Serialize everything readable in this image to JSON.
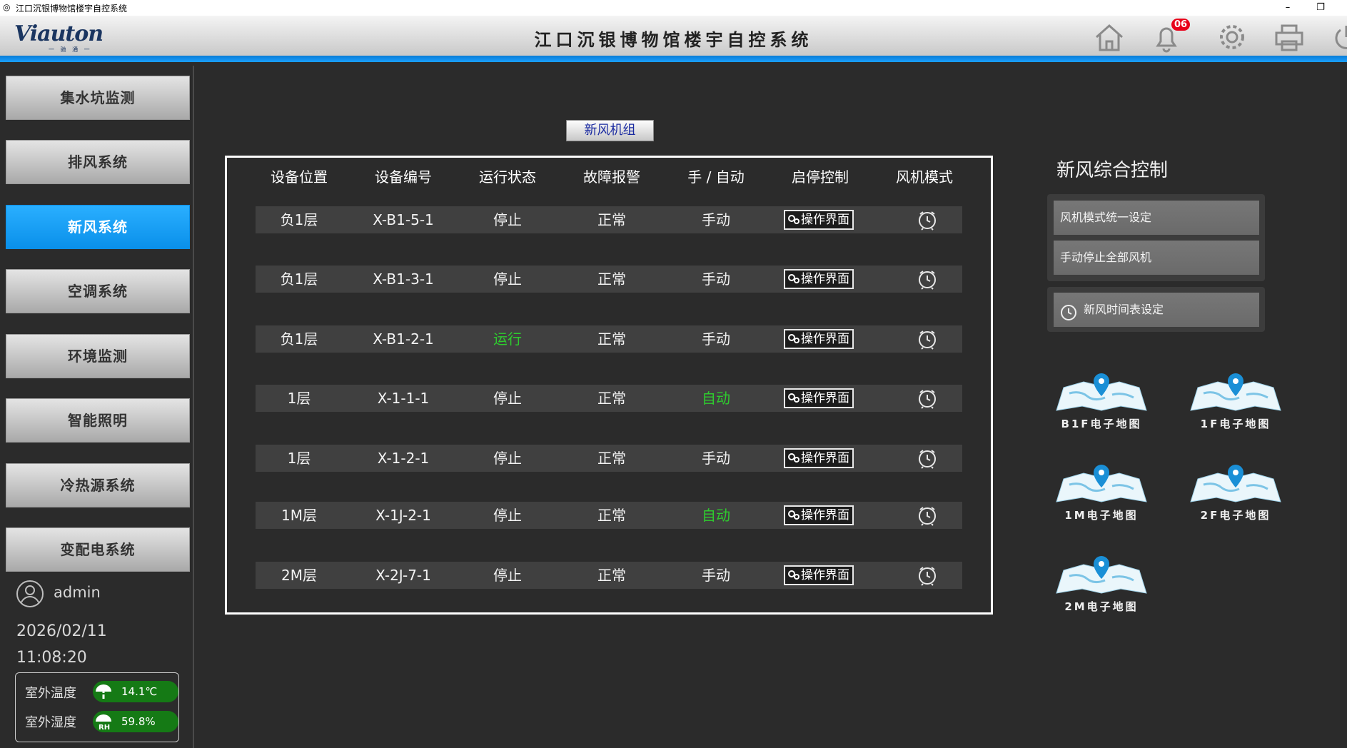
{
  "window": {
    "title": "江口沉银博物馆楼宇自控系统",
    "minimize": "–",
    "maximize": "❐"
  },
  "header": {
    "logo": "Viauton",
    "logo_sub": "一 驰 通 一",
    "title": "江口沉银博物馆楼宇自控系统",
    "alarm_count": "06",
    "icons": [
      "home-icon",
      "bell-icon",
      "gear-icon",
      "printer-icon",
      "power-icon"
    ],
    "accent_color": "#1aa0ff"
  },
  "sidebar": {
    "items": [
      {
        "label": "集水坑监测",
        "active": false
      },
      {
        "label": "排风系统",
        "active": false
      },
      {
        "label": "新风系统",
        "active": true
      },
      {
        "label": "空调系统",
        "active": false
      },
      {
        "label": "环境监测",
        "active": false
      },
      {
        "label": "智能照明",
        "active": false
      },
      {
        "label": "冷热源系统",
        "active": false
      },
      {
        "label": "变配电系统",
        "active": false
      }
    ],
    "user": "admin",
    "date": "2026/02/11",
    "time": "11:08:20",
    "weather": {
      "temp_label": "室外温度",
      "temp_value": "14.1℃",
      "humidity_label": "室外湿度",
      "humidity_value": "59.8%"
    }
  },
  "main": {
    "panel_label": "新风机组",
    "columns": [
      "设备位置",
      "设备编号",
      "运行状态",
      "故障报警",
      "手 / 自动",
      "启停控制",
      "风机模式"
    ],
    "op_label": "操作界面",
    "rows": [
      {
        "location": "负1层",
        "code": "X-B1-5-1",
        "status": "停止",
        "fault": "正常",
        "mode": "手动"
      },
      {
        "location": "负1层",
        "code": "X-B1-3-1",
        "status": "停止",
        "fault": "正常",
        "mode": "手动"
      },
      {
        "location": "负1层",
        "code": "X-B1-2-1",
        "status": "运行",
        "fault": "正常",
        "mode": "手动"
      },
      {
        "location": "1层",
        "code": "X-1-1-1",
        "status": "停止",
        "fault": "正常",
        "mode": "自动"
      },
      {
        "location": "1层",
        "code": "X-1-2-1",
        "status": "停止",
        "fault": "正常",
        "mode": "手动"
      },
      {
        "location": "1M层",
        "code": "X-1J-2-1",
        "status": "停止",
        "fault": "正常",
        "mode": "自动"
      },
      {
        "location": "2M层",
        "code": "X-2J-7-1",
        "status": "停止",
        "fault": "正常",
        "mode": "手动"
      }
    ],
    "status_run_color": "#2ecc2e"
  },
  "right": {
    "title": "新风综合控制",
    "buttons": [
      "风机模式统一设定",
      "手动停止全部风机"
    ],
    "schedule_button": "新风时间表设定",
    "maps": [
      "B1F电子地图",
      "1F电子地图",
      "1M电子地图",
      "2F电子地图",
      "2M电子地图"
    ]
  }
}
